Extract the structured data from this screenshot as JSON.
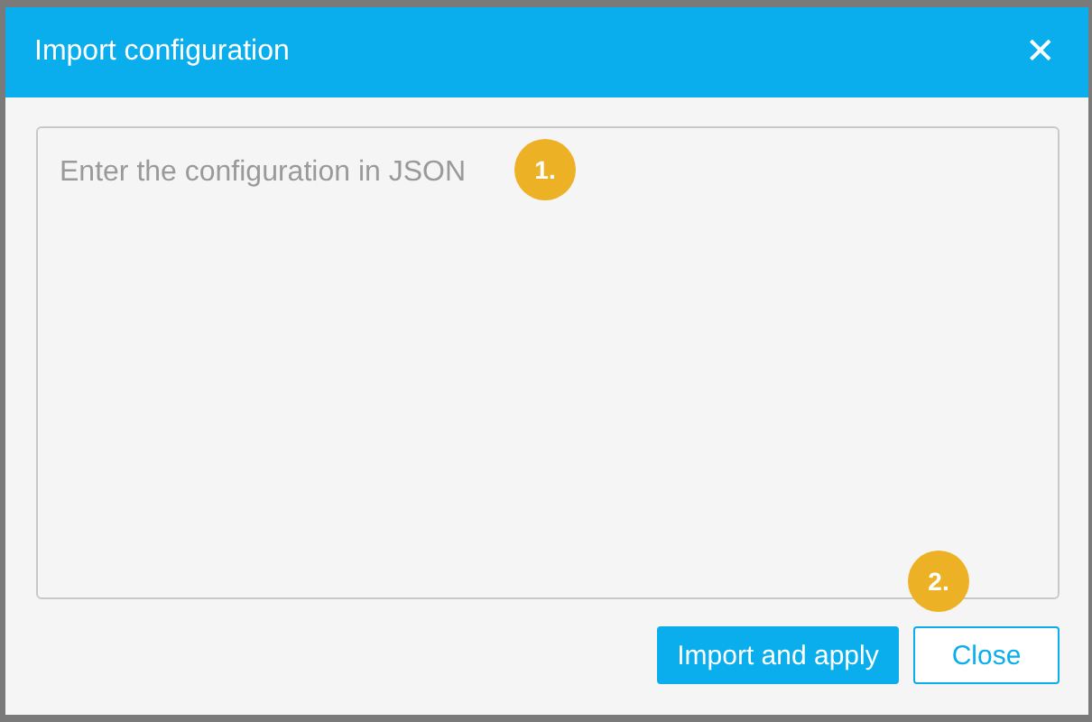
{
  "dialog": {
    "title": "Import configuration",
    "close_icon": "✕"
  },
  "textarea": {
    "placeholder": "Enter the configuration in JSON",
    "callout": "1."
  },
  "footer": {
    "callout": "2."
  },
  "buttons": [
    {
      "label": "Import and apply",
      "kind": "primary"
    },
    {
      "label": "Close",
      "kind": "outline"
    }
  ]
}
